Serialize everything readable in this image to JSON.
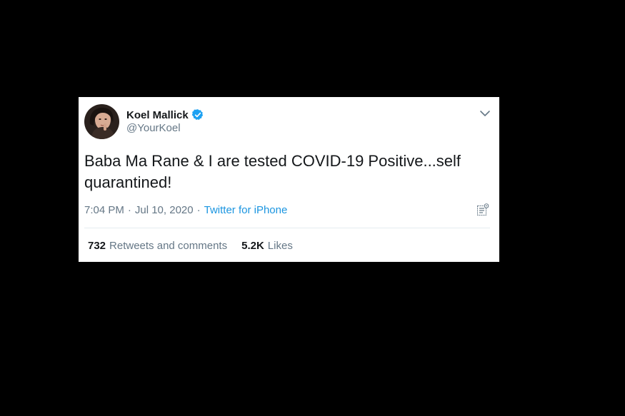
{
  "tweet": {
    "author": {
      "name": "Koel Mallick",
      "handle": "@YourKoel",
      "verified": true
    },
    "text": "Baba Ma Rane & I are tested COVID-19 Positive...self quarantined!",
    "time": "7:04 PM",
    "separator1": "·",
    "date": "Jul 10, 2020",
    "separator2": "·",
    "source": "Twitter for iPhone",
    "stats": {
      "retweets_count": "732",
      "retweets_label": "Retweets and comments",
      "likes_count": "5.2K",
      "likes_label": "Likes"
    }
  },
  "icons": {
    "verified": "verified-badge-icon",
    "caret": "chevron-down-icon",
    "analytics": "analytics-icon"
  },
  "colors": {
    "background": "#000000",
    "card": "#ffffff",
    "accent": "#1da1f2",
    "link": "#1b95e0",
    "primary_text": "#14171a",
    "secondary_text": "#657786"
  }
}
